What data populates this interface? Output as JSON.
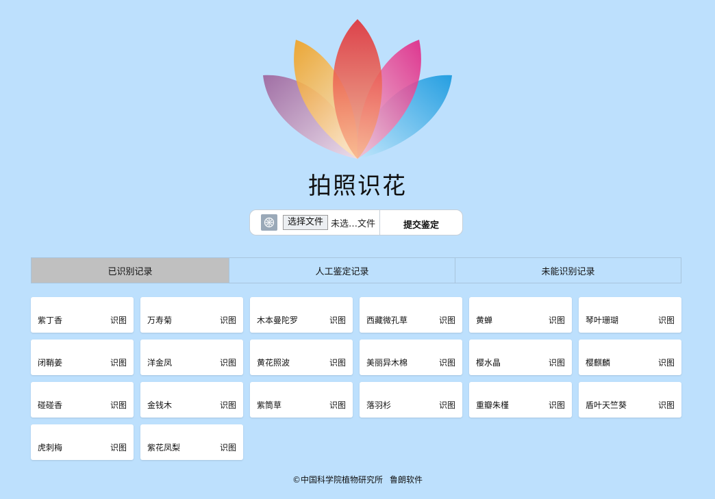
{
  "app": {
    "title": "拍照识花"
  },
  "upload": {
    "choose_file_label": "选择文件",
    "file_status": "未选…文件",
    "submit_label": "提交鉴定"
  },
  "tabs": [
    {
      "label": "已识别记录",
      "active": true
    },
    {
      "label": "人工鉴定记录",
      "active": false
    },
    {
      "label": "未能识别记录",
      "active": false
    }
  ],
  "records": [
    {
      "name": "紫丁香",
      "action": "识图"
    },
    {
      "name": "万寿菊",
      "action": "识图"
    },
    {
      "name": "木本曼陀罗",
      "action": "识图"
    },
    {
      "name": "西藏微孔草",
      "action": "识图"
    },
    {
      "name": "黄蝉",
      "action": "识图"
    },
    {
      "name": "琴叶珊瑚",
      "action": "识图"
    },
    {
      "name": "闭鞘姜",
      "action": "识图"
    },
    {
      "name": "洋金凤",
      "action": "识图"
    },
    {
      "name": "黄花照波",
      "action": "识图"
    },
    {
      "name": "美丽异木棉",
      "action": "识图"
    },
    {
      "name": "樱水晶",
      "action": "识图"
    },
    {
      "name": "樱麒麟",
      "action": "识图"
    },
    {
      "name": "碰碰香",
      "action": "识图"
    },
    {
      "name": "金钱木",
      "action": "识图"
    },
    {
      "name": "紫筒草",
      "action": "识图"
    },
    {
      "name": "落羽杉",
      "action": "识图"
    },
    {
      "name": "重瓣朱槿",
      "action": "识图"
    },
    {
      "name": "盾叶天竺葵",
      "action": "识图"
    },
    {
      "name": "虎刺梅",
      "action": "识图"
    },
    {
      "name": "紫花凤梨",
      "action": "识图"
    }
  ],
  "footer": {
    "copyright": "©中国科学院植物研究所",
    "company": "鲁朗软件"
  },
  "colors": {
    "background": "#bde0fd",
    "active_tab": "#c0c0c0",
    "card": "#ffffff"
  },
  "icons": {
    "logo": "lotus-logo",
    "file": "image-file-icon"
  }
}
